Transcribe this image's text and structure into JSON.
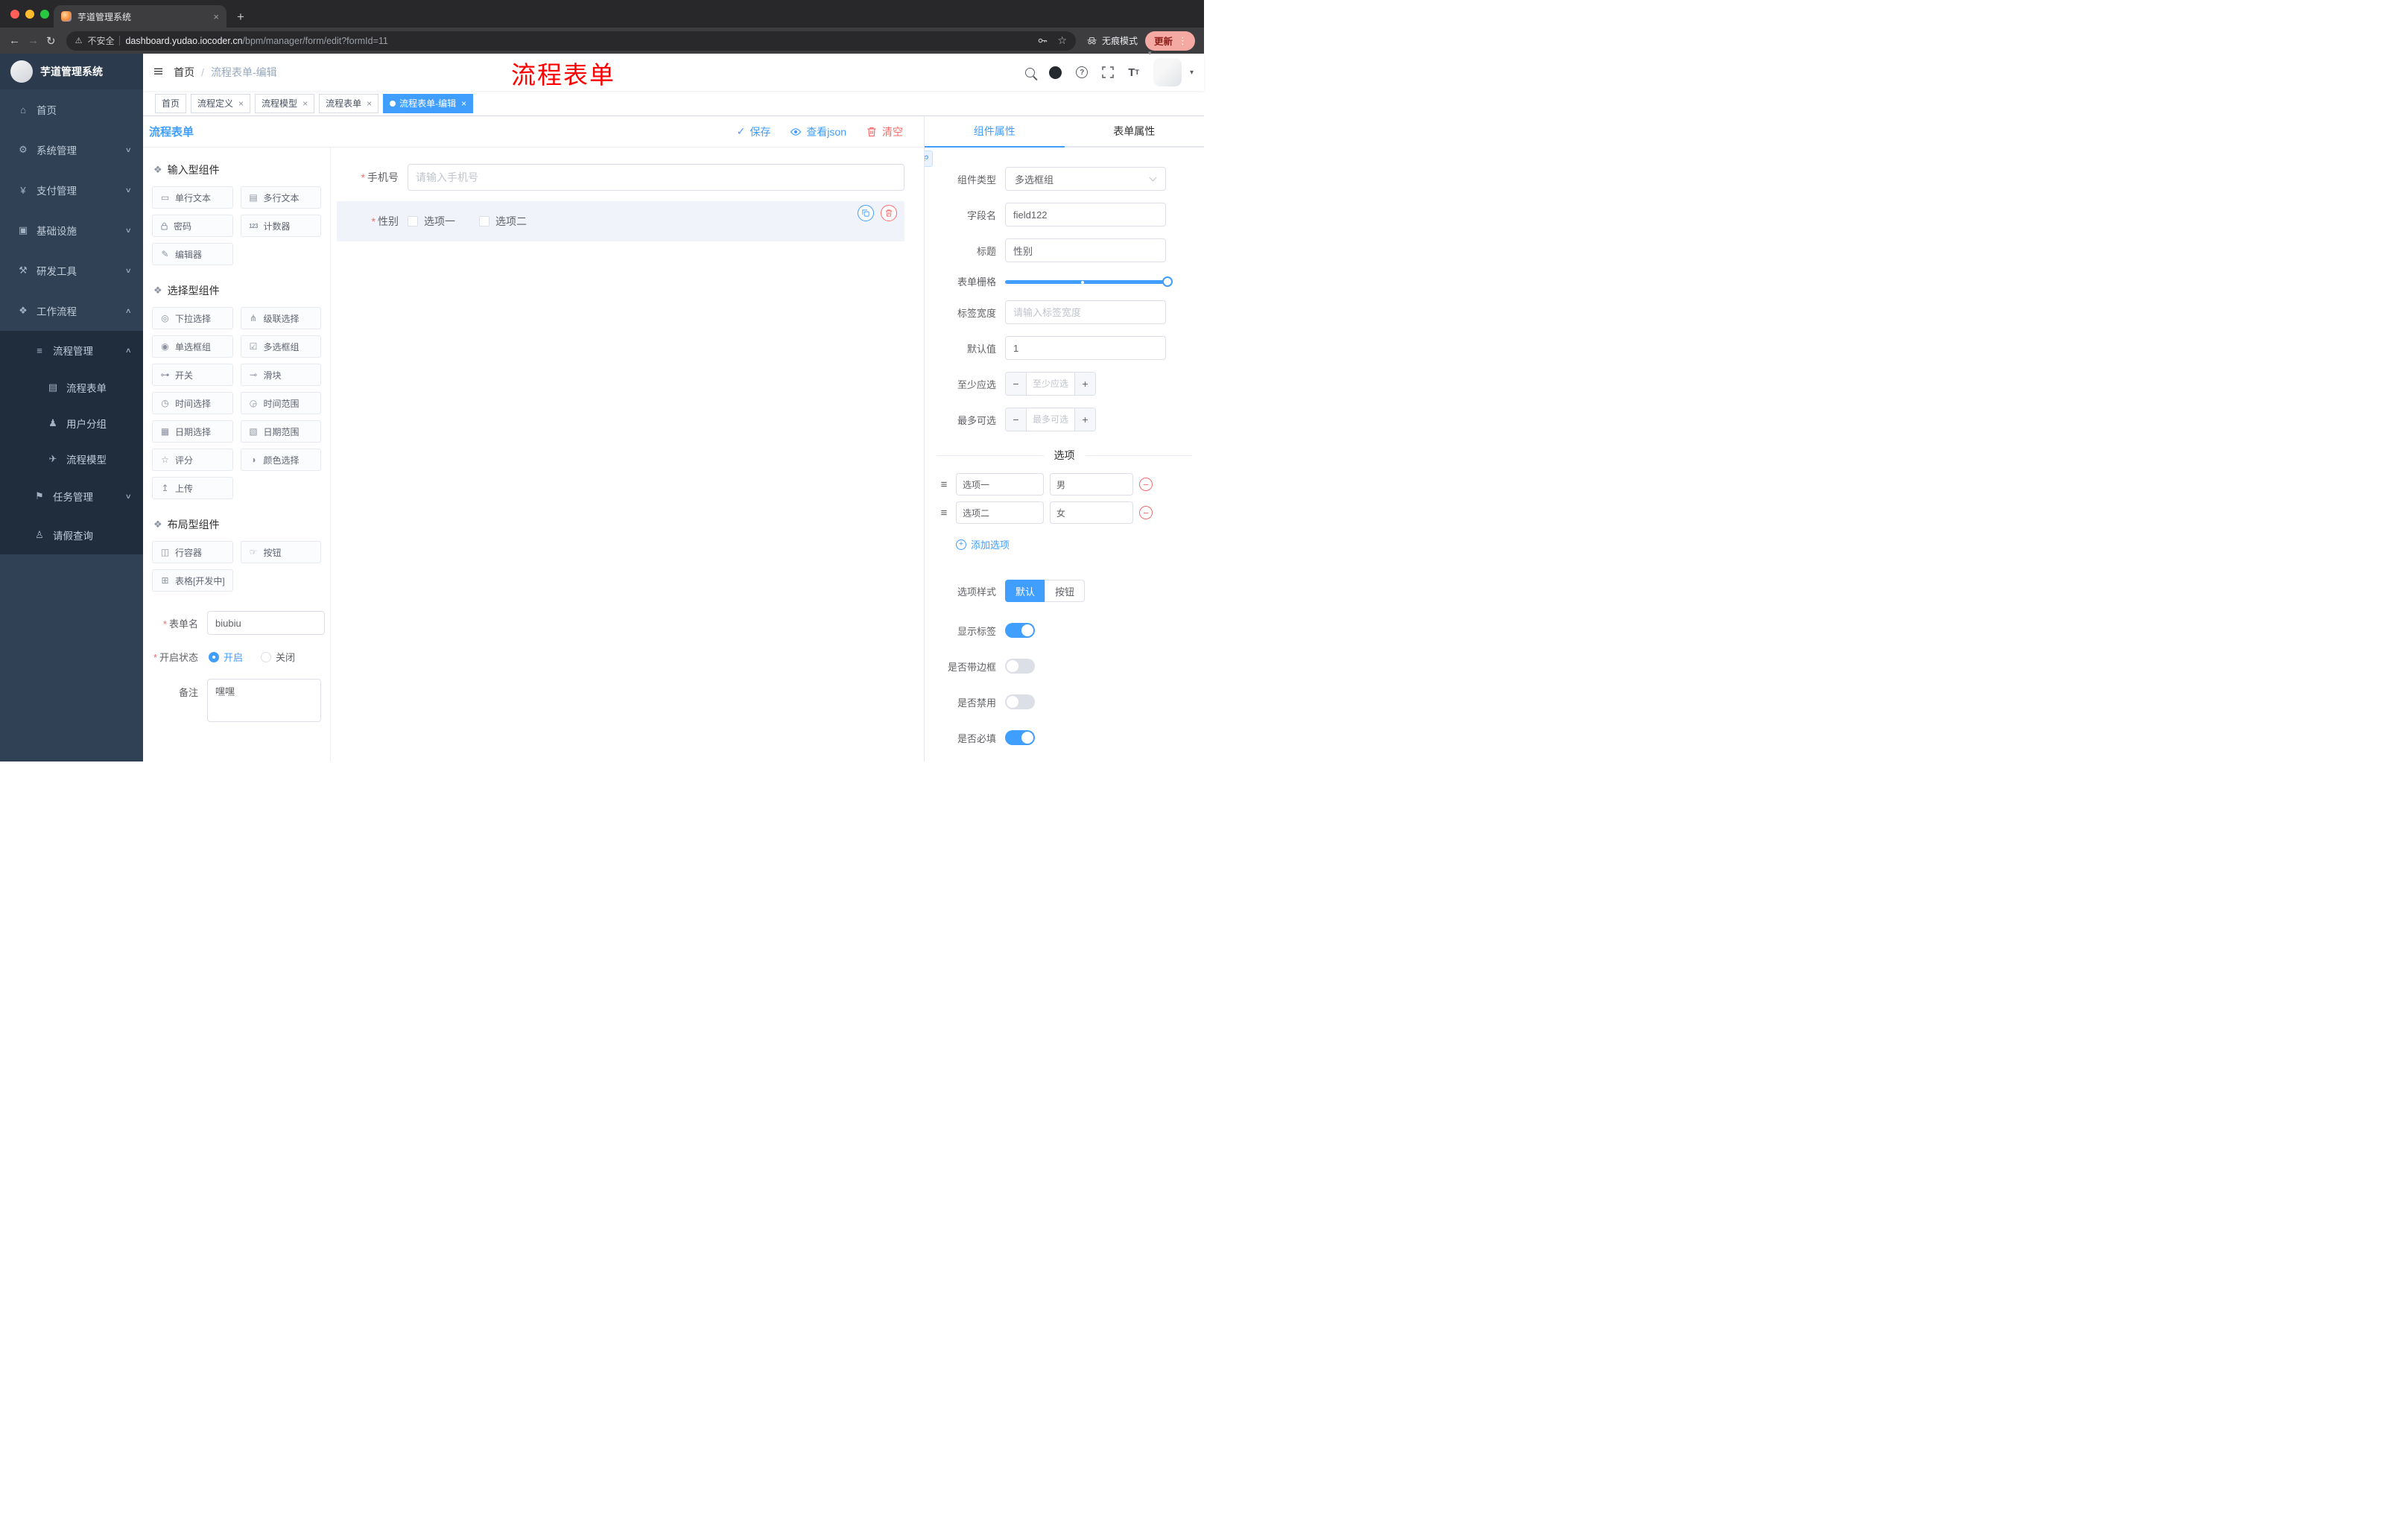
{
  "browser": {
    "tab_title": "芋道管理系统",
    "security_label": "不安全",
    "url_domain": "dashboard.yudao.iocoder.cn",
    "url_path": "/bpm/manager/form/edit?formId=11",
    "incognito_label": "无痕模式",
    "update_label": "更新"
  },
  "sidebar": {
    "app_title": "芋道管理系统",
    "menu": [
      {
        "label": "首页"
      },
      {
        "label": "系统管理",
        "expanded": false
      },
      {
        "label": "支付管理",
        "expanded": false
      },
      {
        "label": "基础设施",
        "expanded": false
      },
      {
        "label": "研发工具",
        "expanded": false
      },
      {
        "label": "工作流程",
        "expanded": true
      },
      {
        "label": "流程管理",
        "expanded": true
      },
      {
        "label": "流程表单"
      },
      {
        "label": "用户分组"
      },
      {
        "label": "流程模型"
      },
      {
        "label": "任务管理",
        "expanded": false
      },
      {
        "label": "请假查询"
      }
    ]
  },
  "navbar": {
    "breadcrumb_home": "首页",
    "breadcrumb_current": "流程表单-编辑"
  },
  "annotation": "流程表单",
  "tags": [
    {
      "label": "首页",
      "closable": false,
      "active": false
    },
    {
      "label": "流程定义",
      "closable": true,
      "active": false
    },
    {
      "label": "流程模型",
      "closable": true,
      "active": false
    },
    {
      "label": "流程表单",
      "closable": true,
      "active": false
    },
    {
      "label": "流程表单-编辑",
      "closable": true,
      "active": true
    }
  ],
  "designer": {
    "title": "流程表单",
    "save_label": "保存",
    "view_json_label": "查看json",
    "clear_label": "清空",
    "groups": {
      "input_title": "输入型组件",
      "select_title": "选择型组件",
      "layout_title": "布局型组件"
    },
    "input_items": [
      "单行文本",
      "多行文本",
      "密码",
      "计数器",
      "编辑器"
    ],
    "select_items": [
      "下拉选择",
      "级联选择",
      "单选框组",
      "多选框组",
      "开关",
      "滑块",
      "时间选择",
      "时间范围",
      "日期选择",
      "日期范围",
      "评分",
      "颜色选择",
      "上传"
    ],
    "layout_items": [
      "行容器",
      "按钮",
      "表格[开发中]"
    ],
    "meta": {
      "name_label": "表单名",
      "name_value": "biubiu",
      "status_label": "开启状态",
      "status_on": "开启",
      "status_off": "关闭",
      "status_selected": "开启",
      "remark_label": "备注",
      "remark_value": "嘿嘿"
    }
  },
  "canvas": {
    "phone_label": "手机号",
    "phone_placeholder": "请输入手机号",
    "gender_label": "性别",
    "gender_opt1": "选项一",
    "gender_opt2": "选项二"
  },
  "props": {
    "tab_component": "组件属性",
    "tab_form": "表单属性",
    "active_tab": "组件属性",
    "rows": {
      "type_label": "组件类型",
      "type_value": "多选框组",
      "field_label": "字段名",
      "field_value": "field122",
      "title_label": "标题",
      "title_value": "性别",
      "grid_label": "表单栅格",
      "grid_value_percent": 100,
      "width_label": "标签宽度",
      "width_placeholder": "请输入标签宽度",
      "default_label": "默认值",
      "default_value": "1",
      "min_label": "至少应选",
      "min_placeholder": "至少应选",
      "max_label": "最多可选",
      "max_placeholder": "最多可选"
    },
    "options_title": "选项",
    "options": [
      {
        "label": "选项一",
        "value": "男"
      },
      {
        "label": "选项二",
        "value": "女"
      }
    ],
    "add_option_label": "添加选项",
    "style_label": "选项样式",
    "style_default": "默认",
    "style_button": "按钮",
    "style_selected": "默认",
    "toggles": {
      "show_label": {
        "label": "显示标签",
        "on": true
      },
      "border": {
        "label": "是否带边框",
        "on": false
      },
      "disabled": {
        "label": "是否禁用",
        "on": false
      },
      "required": {
        "label": "是否必填",
        "on": true
      }
    },
    "colors": {
      "primary": "#409eff",
      "danger": "#f56c6c"
    }
  }
}
